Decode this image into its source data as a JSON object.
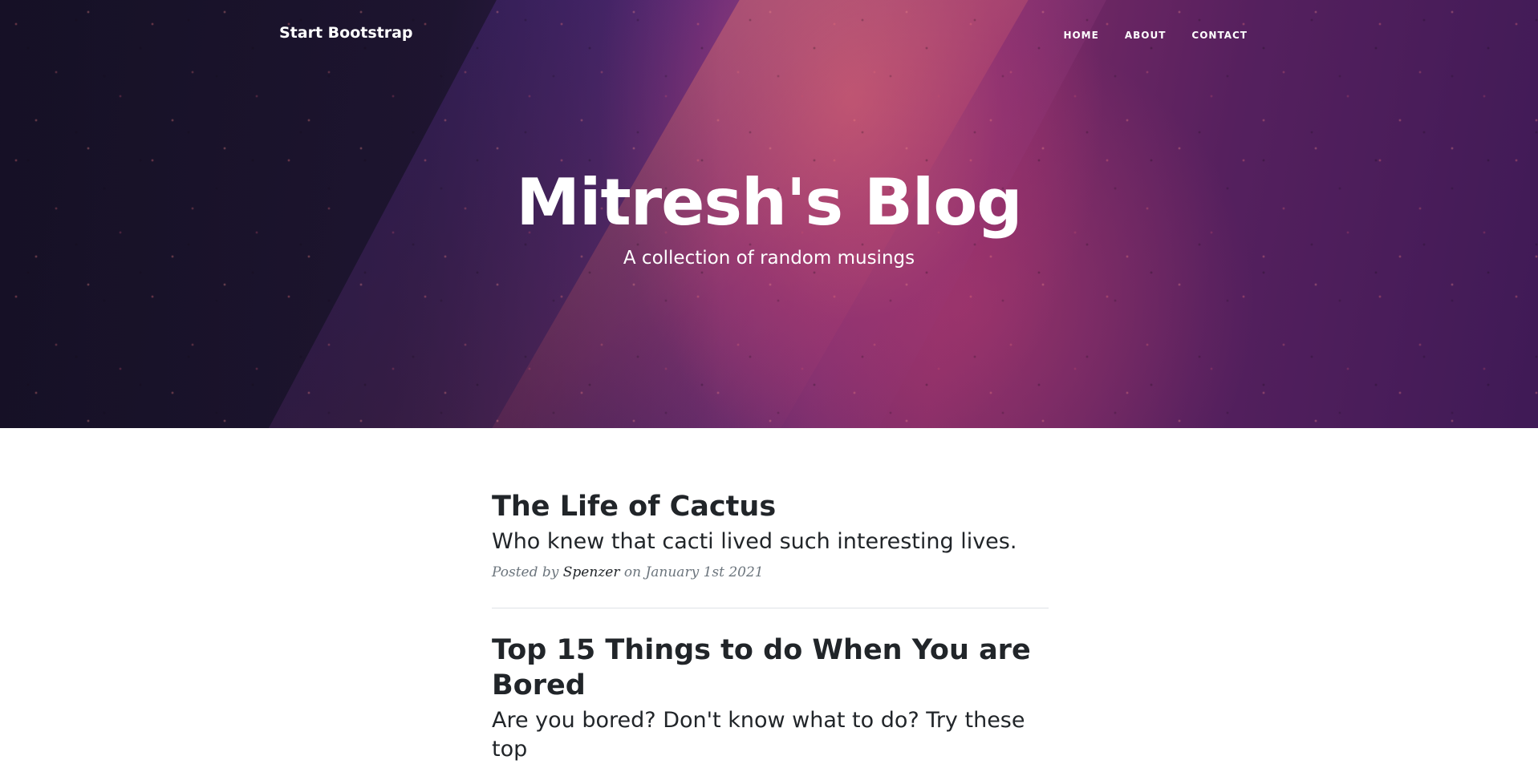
{
  "navbar": {
    "brand": "Start Bootstrap",
    "links": [
      {
        "label": "HOME"
      },
      {
        "label": "ABOUT"
      },
      {
        "label": "CONTACT"
      }
    ]
  },
  "header": {
    "title": "Mitresh's Blog",
    "subtitle": "A collection of random musings"
  },
  "posts": [
    {
      "title": "The Life of Cactus",
      "subtitle": "Who knew that cacti lived such interesting lives.",
      "meta_prefix": "Posted by",
      "author": "Spenzer",
      "meta_suffix": "on January 1st 2021"
    },
    {
      "title": "Top 15 Things to do When You are Bored",
      "subtitle": "Are you bored? Don't know what to do? Try these top"
    }
  ],
  "colors": {
    "text_dark": "#212529",
    "meta_muted": "#6c757d",
    "divider": "#dee2e6",
    "header_accent": "#7a2a66"
  }
}
